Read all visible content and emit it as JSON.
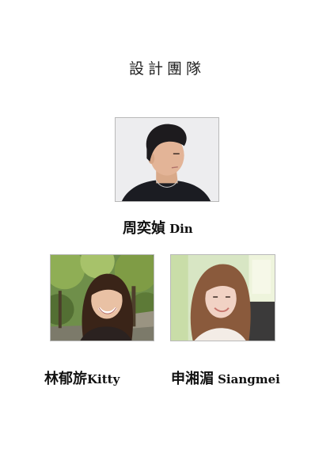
{
  "title": "設計團隊",
  "members": [
    {
      "name_zh": "周奕媜",
      "name_en": "Din"
    },
    {
      "name_zh": "林郁旂",
      "name_en": "Kitty"
    },
    {
      "name_zh": "申湘湄",
      "name_en": "Siangmei"
    }
  ]
}
